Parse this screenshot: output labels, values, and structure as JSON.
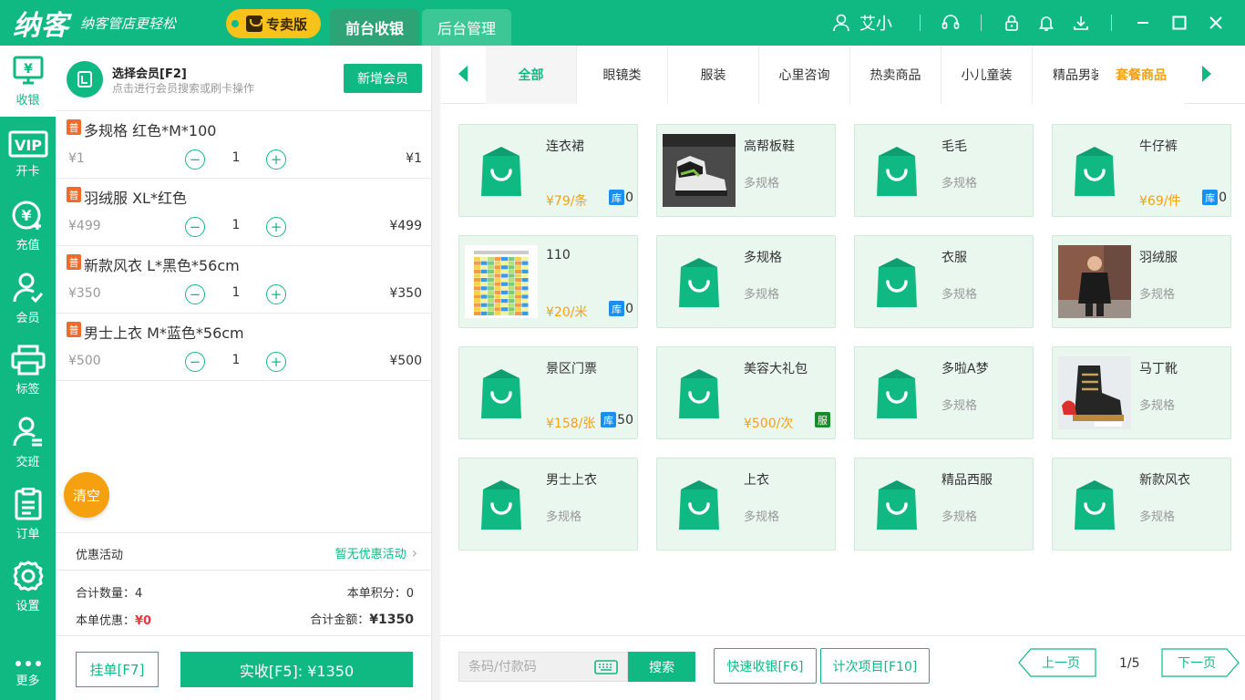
{
  "app": {
    "brand": "纳客",
    "slogan": "纳客管店更轻松",
    "edition": "专卖版",
    "tabs": [
      "前台收银",
      "后台管理"
    ],
    "user_name": "艾小",
    "accent_color": "#10b982"
  },
  "nav": [
    {
      "label": "收银",
      "icon": "cashier-icon"
    },
    {
      "label": "开卡",
      "icon": "vip-card-icon"
    },
    {
      "label": "充值",
      "icon": "recharge-icon"
    },
    {
      "label": "会员",
      "icon": "member-icon"
    },
    {
      "label": "标签",
      "icon": "printer-icon"
    },
    {
      "label": "交班",
      "icon": "shift-icon"
    },
    {
      "label": "订单",
      "icon": "order-icon"
    },
    {
      "label": "设置",
      "icon": "settings-icon"
    },
    {
      "label": "更多",
      "icon": "more-icon"
    }
  ],
  "member": {
    "title": "选择会员[F2]",
    "hint": "点击进行会员搜索或刷卡操作",
    "add_label": "新增会员"
  },
  "cart_items": [
    {
      "badge": "普",
      "name": "多规格 红色*M*100",
      "price": "¥1",
      "qty": "1",
      "total": "¥1"
    },
    {
      "badge": "普",
      "name": "羽绒服 XL*红色",
      "price": "¥499",
      "qty": "1",
      "total": "¥499"
    },
    {
      "badge": "普",
      "name": "新款风衣 L*黑色*56cm",
      "price": "¥350",
      "qty": "1",
      "total": "¥350"
    },
    {
      "badge": "普",
      "name": "男士上衣 M*蓝色*56cm",
      "price": "¥500",
      "qty": "1",
      "total": "¥500"
    }
  ],
  "cart": {
    "clear_label": "清空",
    "promo_label": "优惠活动",
    "promo_value": "暂无优惠活动",
    "total_qty_label": "合计数量：",
    "total_qty": "4",
    "points_label": "本单积分：",
    "points": "0",
    "discount_label": "本单优惠：",
    "discount": "¥0",
    "total_amount_label": "合计金额：",
    "total_amount": "¥1350",
    "hold_label": "挂单[F7]",
    "pay_label": "实收[F5]: ¥1350"
  },
  "categories": [
    "全部",
    "眼镜类",
    "服装",
    "心里咨询",
    "热卖商品",
    "小儿童装",
    "精品男装",
    "套餐商品"
  ],
  "products": [
    {
      "name": "连衣裙",
      "spec": "",
      "price": "¥79/条",
      "stock_tag": "库",
      "stock": "0",
      "image": "bag"
    },
    {
      "name": "高帮板鞋",
      "spec": "多规格",
      "price": "",
      "stock_tag": "",
      "stock": "",
      "image": "sneaker"
    },
    {
      "name": "毛毛",
      "spec": "多规格",
      "price": "",
      "stock_tag": "",
      "stock": "",
      "image": "bag"
    },
    {
      "name": "牛仔裤",
      "spec": "",
      "price": "¥69/件",
      "stock_tag": "库",
      "stock": "0",
      "image": "bag"
    },
    {
      "name": "110",
      "spec": "",
      "price": "¥20/米",
      "stock_tag": "库",
      "stock": "0",
      "image": "spreadsheet"
    },
    {
      "name": "多规格",
      "spec": "多规格",
      "price": "",
      "stock_tag": "",
      "stock": "",
      "image": "bag"
    },
    {
      "name": "衣服",
      "spec": "多规格",
      "price": "",
      "stock_tag": "",
      "stock": "",
      "image": "bag"
    },
    {
      "name": "羽绒服",
      "spec": "多规格",
      "price": "",
      "stock_tag": "",
      "stock": "",
      "image": "person"
    },
    {
      "name": "景区门票",
      "spec": "",
      "price": "¥158/张",
      "stock_tag": "库",
      "stock": "50",
      "image": "bag"
    },
    {
      "name": "美容大礼包",
      "spec": "",
      "price": "¥500/次",
      "stock_tag": "服",
      "stock": "",
      "image": "bag"
    },
    {
      "name": "多啦A梦",
      "spec": "多规格",
      "price": "",
      "stock_tag": "",
      "stock": "",
      "image": "bag"
    },
    {
      "name": "马丁靴",
      "spec": "多规格",
      "price": "",
      "stock_tag": "",
      "stock": "",
      "image": "boot"
    },
    {
      "name": "男士上衣",
      "spec": "多规格",
      "price": "",
      "stock_tag": "",
      "stock": "",
      "image": "bag"
    },
    {
      "name": "上衣",
      "spec": "多规格",
      "price": "",
      "stock_tag": "",
      "stock": "",
      "image": "bag"
    },
    {
      "name": "精品西服",
      "spec": "多规格",
      "price": "",
      "stock_tag": "",
      "stock": "",
      "image": "bag"
    },
    {
      "name": "新款风衣",
      "spec": "多规格",
      "price": "",
      "stock_tag": "",
      "stock": "",
      "image": "bag"
    }
  ],
  "footer": {
    "search_placeholder": "条码/付款码",
    "search_label": "搜索",
    "quick_label": "快速收银[F6]",
    "count_label": "计次项目[F10]",
    "prev_label": "上一页",
    "page_info": "1/5",
    "next_label": "下一页"
  }
}
